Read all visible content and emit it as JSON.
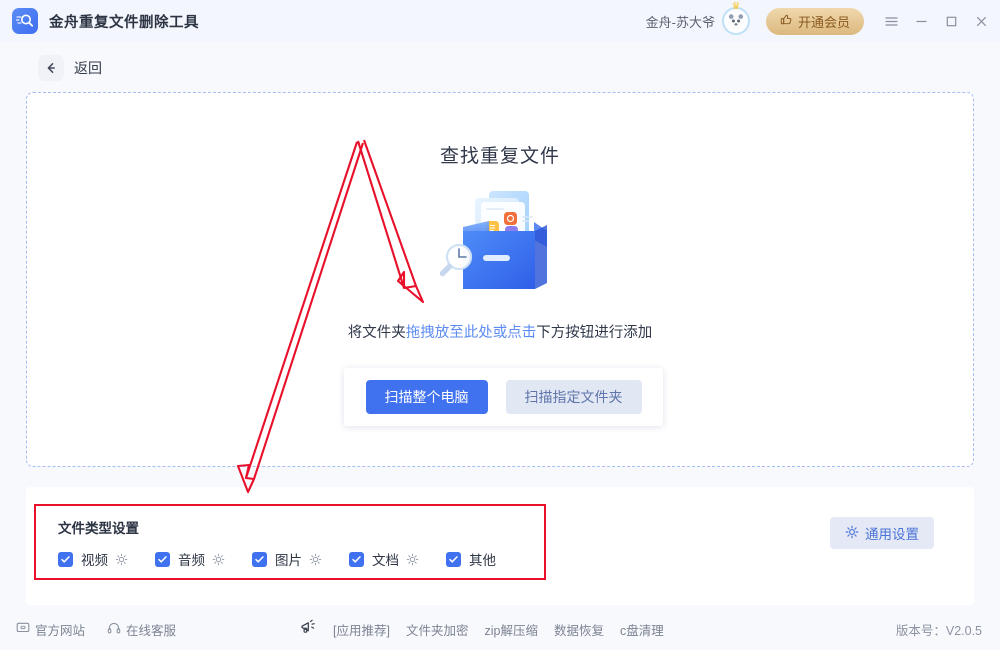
{
  "titlebar": {
    "app_title": "金舟重复文件删除工具",
    "app_icon": "magnifier-app-icon",
    "user_name": "金舟-苏大爷",
    "avatar_icon": "panda-avatar",
    "crown_icon": "crown-icon",
    "vip_label": "开通会员",
    "vip_icon": "thumbs-up-icon",
    "menu_icon": "hamburger-menu-icon",
    "minimize_icon": "minimize-icon",
    "maximize_icon": "maximize-icon",
    "close_icon": "close-icon"
  },
  "backbar": {
    "back_icon": "arrow-left-icon",
    "back_label": "返回"
  },
  "dropzone": {
    "title": "查找重复文件",
    "illustration": "folder-search-illustration",
    "hint_prefix": "将文件夹",
    "hint_highlight": "拖拽放至此处或点击",
    "hint_suffix": "下方按钮进行添加",
    "scan_all_label": "扫描整个电脑",
    "scan_folder_label": "扫描指定文件夹"
  },
  "filetypes": {
    "panel_title": "文件类型设置",
    "items": [
      {
        "label": "视频",
        "checked": true,
        "has_gear": true
      },
      {
        "label": "音频",
        "checked": true,
        "has_gear": true
      },
      {
        "label": "图片",
        "checked": true,
        "has_gear": true
      },
      {
        "label": "文档",
        "checked": true,
        "has_gear": true
      },
      {
        "label": "其他",
        "checked": true,
        "has_gear": false
      }
    ],
    "general_settings_label": "通用设置",
    "general_settings_icon": "gear-icon"
  },
  "footer": {
    "website_label": "官方网站",
    "website_icon": "monitor-icon",
    "support_label": "在线客服",
    "support_icon": "headset-icon",
    "promo_icon": "megaphone-icon",
    "recommend_label": "[应用推荐]",
    "links": [
      "文件夹加密",
      "zip解压缩",
      "数据恢复",
      "c盘清理"
    ],
    "version_label": "版本号：V2.0.5"
  },
  "colors": {
    "accent": "#4072ef",
    "accent_light": "#5c8cf2",
    "annotation_red": "#e8102a",
    "vip_gold": "#dcb87e",
    "dashed_border": "#a6bdf1",
    "page_bg": "#f7f9fd"
  }
}
